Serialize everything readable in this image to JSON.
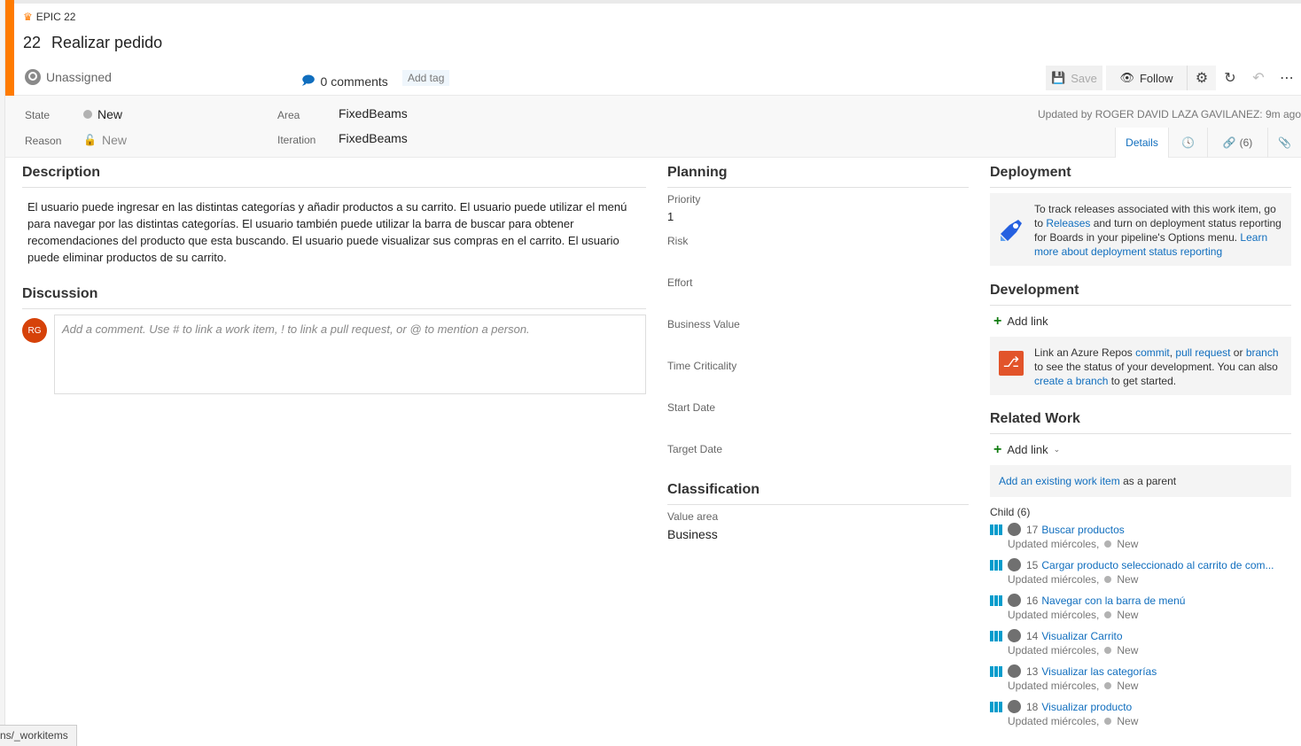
{
  "header": {
    "epic_label": "EPIC 22",
    "id": "22",
    "title": "Realizar pedido",
    "assigned": "Unassigned",
    "comments": "0 comments",
    "add_tag": "Add tag",
    "save_label": "Save",
    "follow_label": "Follow"
  },
  "fields": {
    "state_label": "State",
    "state_value": "New",
    "reason_label": "Reason",
    "reason_value": "New",
    "area_label": "Area",
    "area_value": "FixedBeams",
    "iteration_label": "Iteration",
    "iteration_value": "FixedBeams",
    "updated_by": "Updated by ROGER DAVID LAZA GAVILANEZ: 9m ago"
  },
  "tabs": {
    "details": "Details",
    "links": "(6)"
  },
  "description": {
    "title": "Description",
    "text": "El usuario puede ingresar en las distintas categorías y añadir productos a su carrito. El usuario puede utilizar el menú para navegar por las distintas categorías. El usuario también puede utilizar la barra de buscar para obtener recomendaciones del producto que esta buscando. El usuario puede visualizar sus compras en el carrito. El usuario puede eliminar productos de su carrito."
  },
  "discussion": {
    "title": "Discussion",
    "avatar_initials": "RG",
    "placeholder": "Add a comment. Use # to link a work item, ! to link a pull request, or @ to mention a person."
  },
  "planning": {
    "title": "Planning",
    "priority_label": "Priority",
    "priority_value": "1",
    "risk_label": "Risk",
    "effort_label": "Effort",
    "business_value_label": "Business Value",
    "time_criticality_label": "Time Criticality",
    "start_date_label": "Start Date",
    "target_date_label": "Target Date"
  },
  "classification": {
    "title": "Classification",
    "value_area_label": "Value area",
    "value_area_value": "Business"
  },
  "deployment": {
    "title": "Deployment",
    "text1": "To track releases associated with this work item, go to ",
    "releases_link": "Releases",
    "text2": " and turn on deployment status reporting for Boards in your pipeline's Options menu. ",
    "learn_link": "Learn more about deployment status reporting"
  },
  "development": {
    "title": "Development",
    "add_link": "Add link",
    "text1": "Link an Azure Repos ",
    "commit_link": "commit",
    "sep1": ", ",
    "pr_link": "pull request",
    "sep2": " or ",
    "branch_link": "branch",
    "text2": " to see the status of your development. You can also ",
    "create_branch_link": "create a branch",
    "text3": " to get started."
  },
  "related_work": {
    "title": "Related Work",
    "add_link": "Add link",
    "existing_link": "Add an existing work item",
    "existing_suffix": " as a parent",
    "child_header": "Child (6)",
    "children": [
      {
        "id": "17",
        "title": "Buscar productos",
        "updated": "Updated miércoles,",
        "state": "New"
      },
      {
        "id": "15",
        "title": "Cargar producto seleccionado al carrito de com...",
        "updated": "Updated miércoles,",
        "state": "New"
      },
      {
        "id": "16",
        "title": "Navegar con la barra de menú",
        "updated": "Updated miércoles,",
        "state": "New"
      },
      {
        "id": "14",
        "title": "Visualizar Carrito",
        "updated": "Updated miércoles,",
        "state": "New"
      },
      {
        "id": "13",
        "title": "Visualizar las categorías",
        "updated": "Updated miércoles,",
        "state": "New"
      },
      {
        "id": "18",
        "title": "Visualizar producto",
        "updated": "Updated miércoles,",
        "state": "New"
      }
    ]
  },
  "status_bar": {
    "url": "ns/_workitems"
  },
  "colors": {
    "epic_orange": "#ff7b00",
    "link_blue": "#106ebe",
    "board_blue": "#009ccc",
    "avatar_red": "#d64209"
  }
}
